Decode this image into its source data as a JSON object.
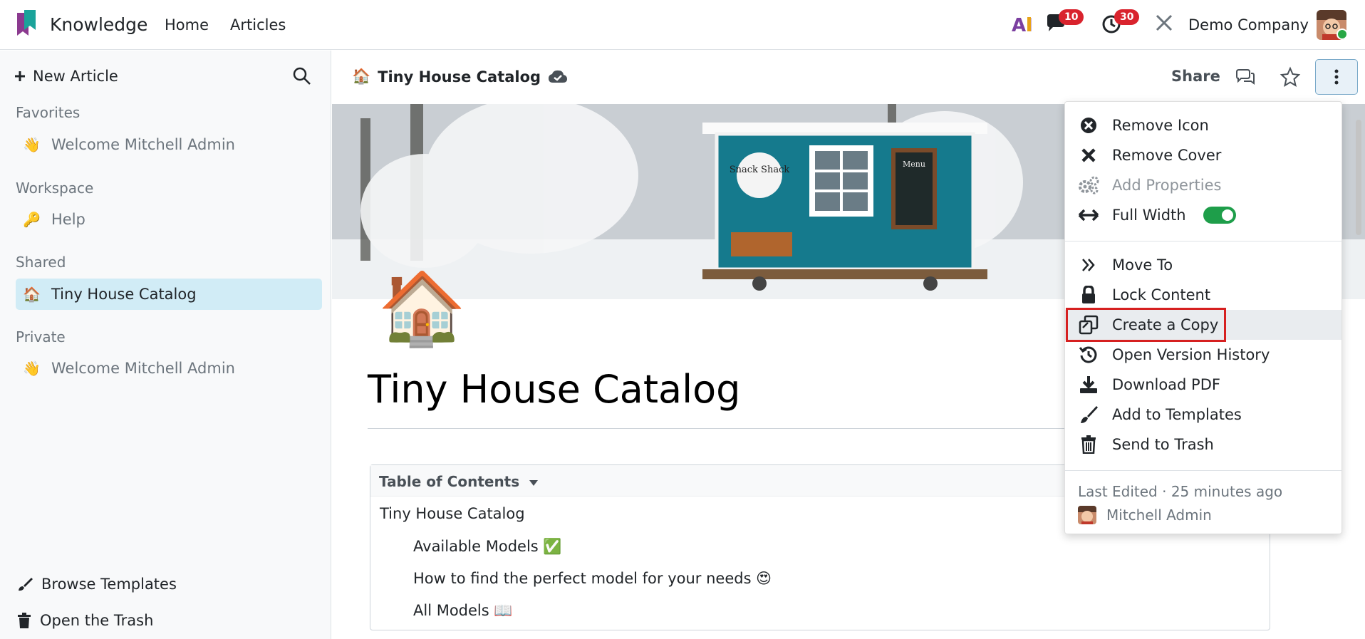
{
  "navbar": {
    "app_name": "Knowledge",
    "home": "Home",
    "articles": "Articles",
    "ai_label": "AI",
    "messages_count": "10",
    "activities_count": "30",
    "company": "Demo Company"
  },
  "sidebar": {
    "new_article": "New Article",
    "favorites_title": "Favorites",
    "favorites": [
      {
        "emoji": "👋",
        "label": "Welcome Mitchell Admin"
      }
    ],
    "workspace_title": "Workspace",
    "workspace": [
      {
        "emoji": "🔑",
        "label": "Help"
      }
    ],
    "shared_title": "Shared",
    "shared": [
      {
        "emoji": "🏠",
        "label": "Tiny House Catalog"
      }
    ],
    "private_title": "Private",
    "private": [
      {
        "emoji": "👋",
        "label": "Welcome Mitchell Admin"
      }
    ],
    "browse_templates": "Browse Templates",
    "open_trash": "Open the Trash"
  },
  "header": {
    "breadcrumb_emoji": "🏠",
    "breadcrumb": "Tiny House Catalog",
    "share": "Share"
  },
  "article": {
    "emoji": "🏠",
    "title": "Tiny House Catalog",
    "toc_title": "Table of Contents",
    "toc": [
      {
        "label": "Tiny House Catalog"
      },
      {
        "label": "Available Models ✅"
      },
      {
        "label": "How to find the perfect model for your needs 😍"
      },
      {
        "label": "All Models 📖"
      }
    ]
  },
  "cover": {
    "sign_text": "Snack Shack",
    "menu_text": "Menu"
  },
  "menu": {
    "remove_icon": "Remove Icon",
    "remove_cover": "Remove Cover",
    "add_properties": "Add Properties",
    "full_width": "Full Width",
    "full_width_on": true,
    "move_to": "Move To",
    "lock_content": "Lock Content",
    "create_copy": "Create a Copy",
    "version_history": "Open Version History",
    "download_pdf": "Download PDF",
    "add_templates": "Add to Templates",
    "send_trash": "Send to Trash",
    "last_edited": "Last Edited · 25 minutes ago",
    "editor": "Mitchell Admin"
  },
  "colors": {
    "accent_active": "#d1ecf6",
    "toggle_on": "#1e9e4a",
    "badge": "#d9232d",
    "highlight": "#d62020"
  }
}
